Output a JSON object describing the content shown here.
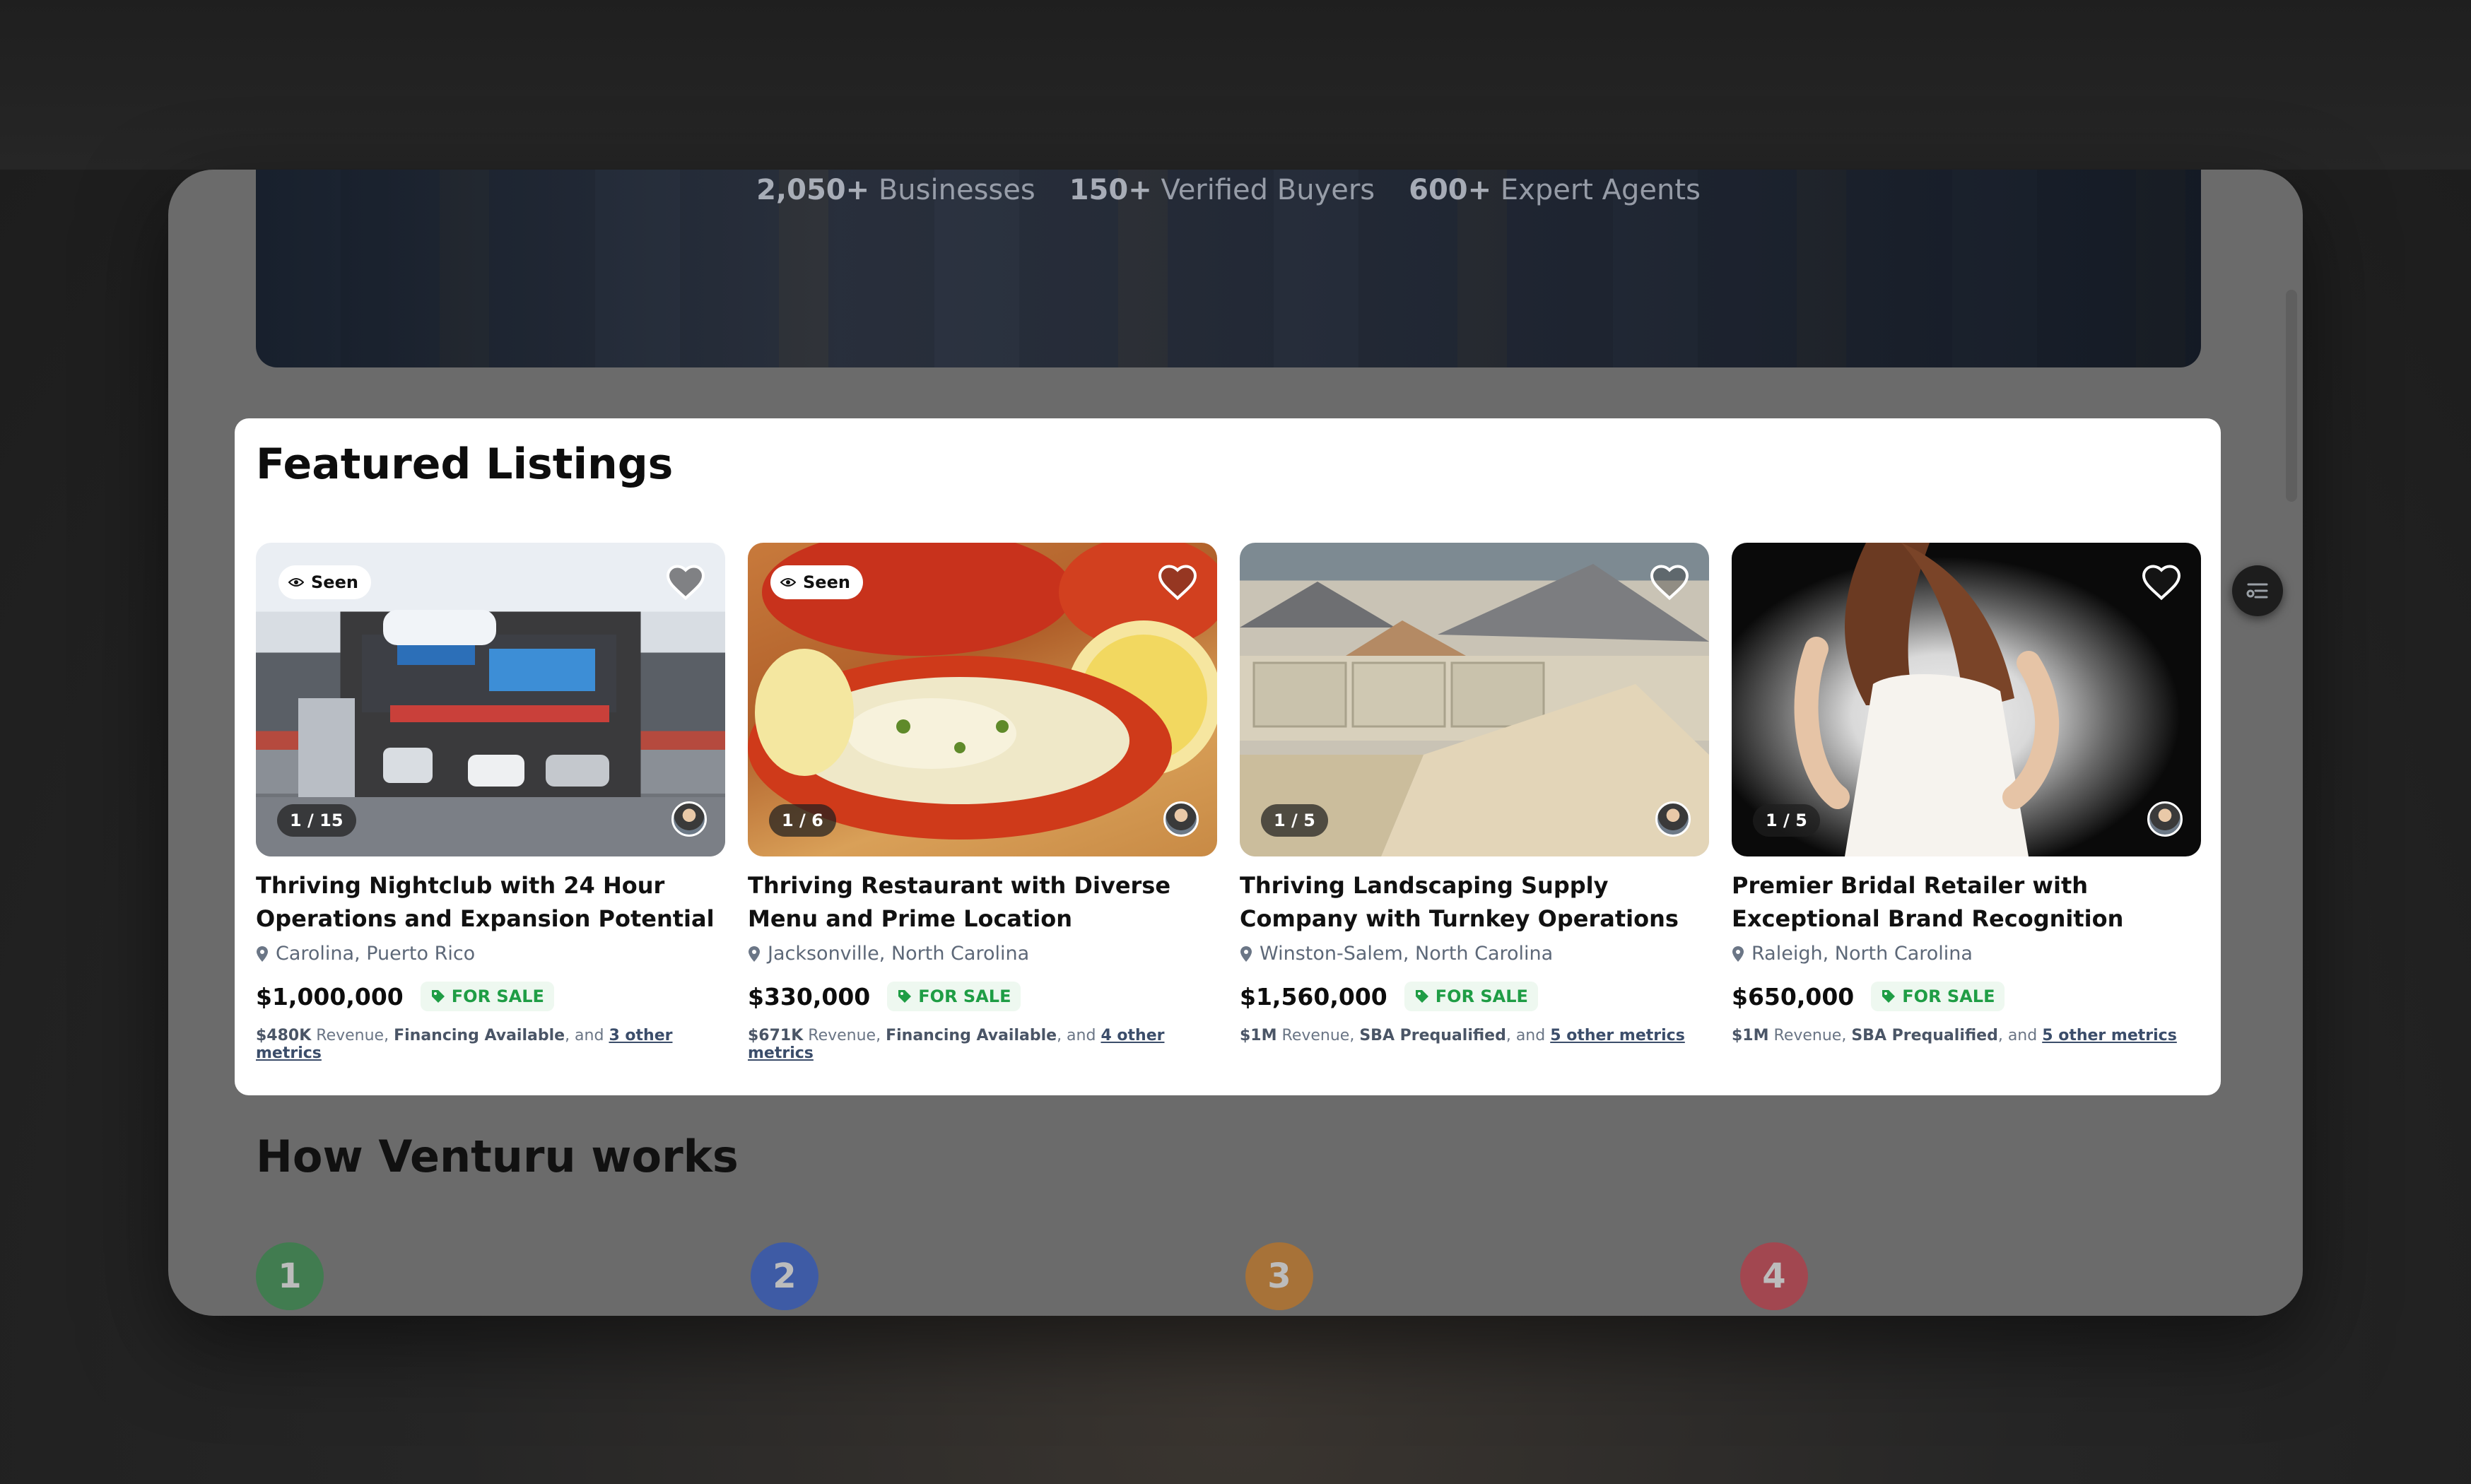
{
  "hero": {
    "stats": [
      {
        "value": "2,050+",
        "label": "Businesses"
      },
      {
        "value": "150+",
        "label": "Verified Buyers"
      },
      {
        "value": "600+",
        "label": "Expert Agents"
      }
    ]
  },
  "featured": {
    "title": "Featured Listings",
    "listings": [
      {
        "seen": "Seen",
        "counter": "1 / 15",
        "title": "Thriving Nightclub with 24 Hour Operations and Expansion Potential",
        "location": "Carolina, Puerto Rico",
        "price": "$1,000,000",
        "status": "FOR SALE",
        "metric1": "$480K",
        "metric1_label": "Revenue,",
        "metric2": "Financing Available",
        "metric_and": ", and",
        "more": "3 other metrics",
        "favorited": true
      },
      {
        "seen": "Seen",
        "counter": "1 / 6",
        "title": "Thriving Restaurant with Diverse Menu and Prime Location",
        "location": "Jacksonville, North Carolina",
        "price": "$330,000",
        "status": "FOR SALE",
        "metric1": "$671K",
        "metric1_label": "Revenue,",
        "metric2": "Financing Available",
        "metric_and": ", and",
        "more": "4 other metrics",
        "favorited": false
      },
      {
        "seen": "",
        "counter": "1 / 5",
        "title": "Thriving Landscaping Supply Company with Turnkey Operations",
        "location": "Winston-Salem, North Carolina",
        "price": "$1,560,000",
        "status": "FOR SALE",
        "metric1": "$1M",
        "metric1_label": "Revenue,",
        "metric2": "SBA Prequalified",
        "metric_and": ", and",
        "more": "5 other metrics",
        "favorited": false
      },
      {
        "seen": "",
        "counter": "1 / 5",
        "title": "Premier Bridal Retailer with Exceptional Brand Recognition",
        "location": "Raleigh, North Carolina",
        "price": "$650,000",
        "status": "FOR SALE",
        "metric1": "$1M",
        "metric1_label": "Revenue,",
        "metric2": "SBA Prequalified",
        "metric_and": ", and",
        "more": "5 other metrics",
        "favorited": false
      }
    ]
  },
  "how": {
    "title": "How Venturu works",
    "steps": [
      "1",
      "2",
      "3",
      "4"
    ],
    "step_colors": [
      "#1f8a3a",
      "#1a4fd6",
      "#d9780f",
      "#d02a3a"
    ]
  },
  "icons": {
    "seen": "eye-icon",
    "favorite": "heart-icon",
    "location": "map-pin-icon",
    "status": "tag-icon",
    "side": "filter-list-icon"
  }
}
